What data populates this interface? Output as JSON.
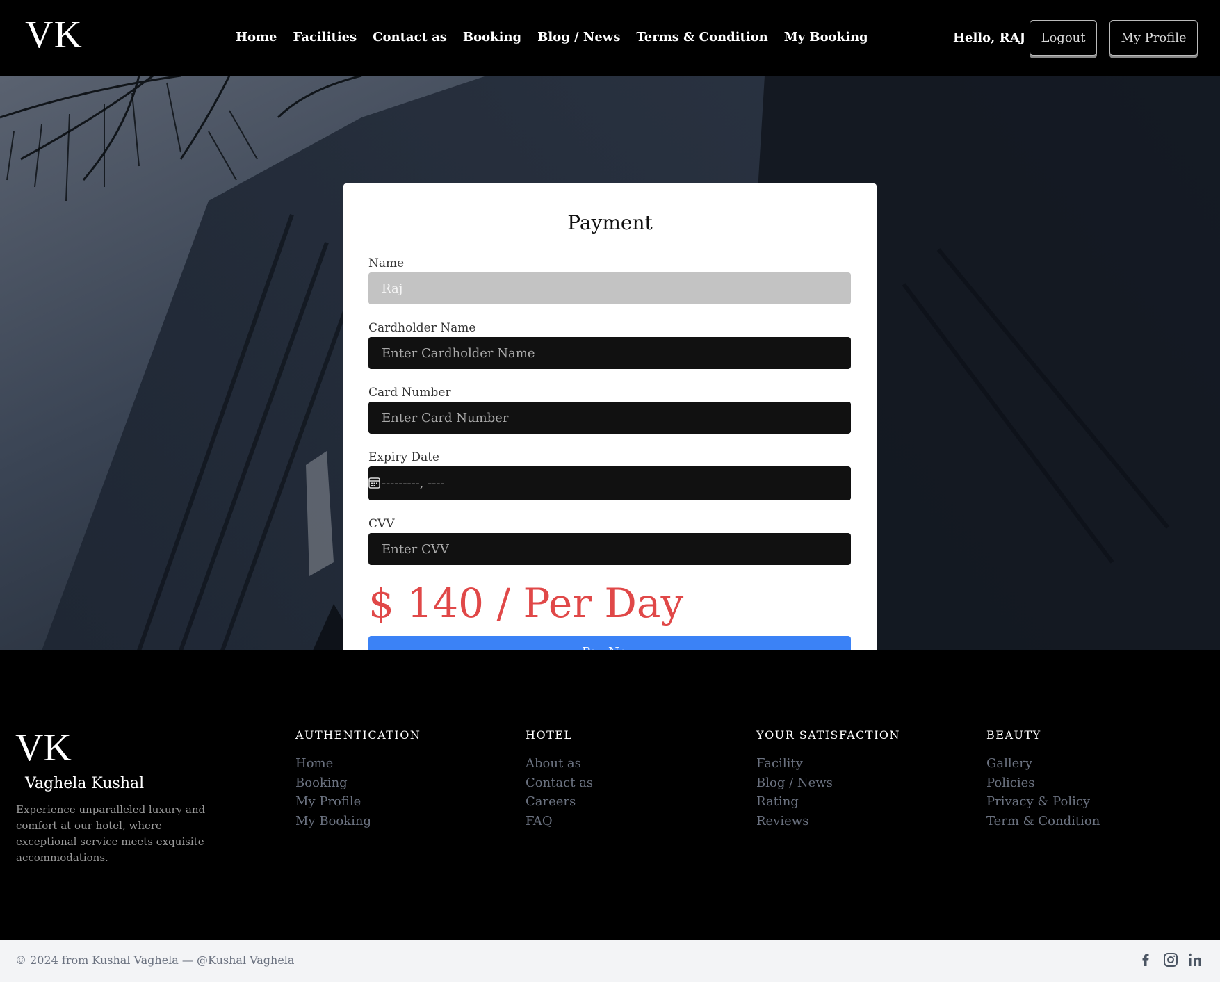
{
  "header": {
    "logo": "VK",
    "nav": [
      "Home",
      "Facilities",
      "Contact as",
      "Booking",
      "Blog / News",
      "Terms & Condition",
      "My Booking"
    ],
    "greeting": "Hello, RAJ",
    "logout_label": "Logout",
    "profile_label": "My Profile"
  },
  "payment": {
    "title": "Payment",
    "name_label": "Name",
    "name_value": "Raj",
    "cardholder_label": "Cardholder Name",
    "cardholder_placeholder": "Enter Cardholder Name",
    "card_number_label": "Card Number",
    "card_number_placeholder": "Enter Card Number",
    "expiry_label": "Expiry Date",
    "expiry_placeholder": "---------, ----",
    "cvv_label": "CVV",
    "cvv_placeholder": "Enter CVV",
    "price": "$ 140 / Per Day",
    "pay_label": "Pay Now"
  },
  "footer": {
    "logo": "VK",
    "name": "Vaghela Kushal",
    "description": "Experience unparalleled luxury and comfort at our hotel, where exceptional service meets exquisite accommodations.",
    "columns": [
      {
        "title": "AUTHENTICATION",
        "items": [
          "Home",
          "Booking",
          "My Profile",
          "My Booking"
        ]
      },
      {
        "title": "HOTEL",
        "items": [
          "About as",
          "Contact as",
          "Careers",
          "FAQ"
        ]
      },
      {
        "title": "YOUR SATISFACTION",
        "items": [
          "Facility",
          "Blog / News",
          "Rating",
          "Reviews"
        ]
      },
      {
        "title": "BEAUTY",
        "items": [
          "Gallery",
          "Policies",
          "Privacy & Policy",
          "Term & Condition"
        ]
      }
    ],
    "copyright": "© 2024 from Kushal Vaghela — @Kushal Vaghela",
    "social_icons": [
      "facebook-icon",
      "instagram-icon",
      "linkedin-icon"
    ]
  },
  "colors": {
    "accent_blue": "#3b82f6",
    "price_red": "#e04848"
  }
}
